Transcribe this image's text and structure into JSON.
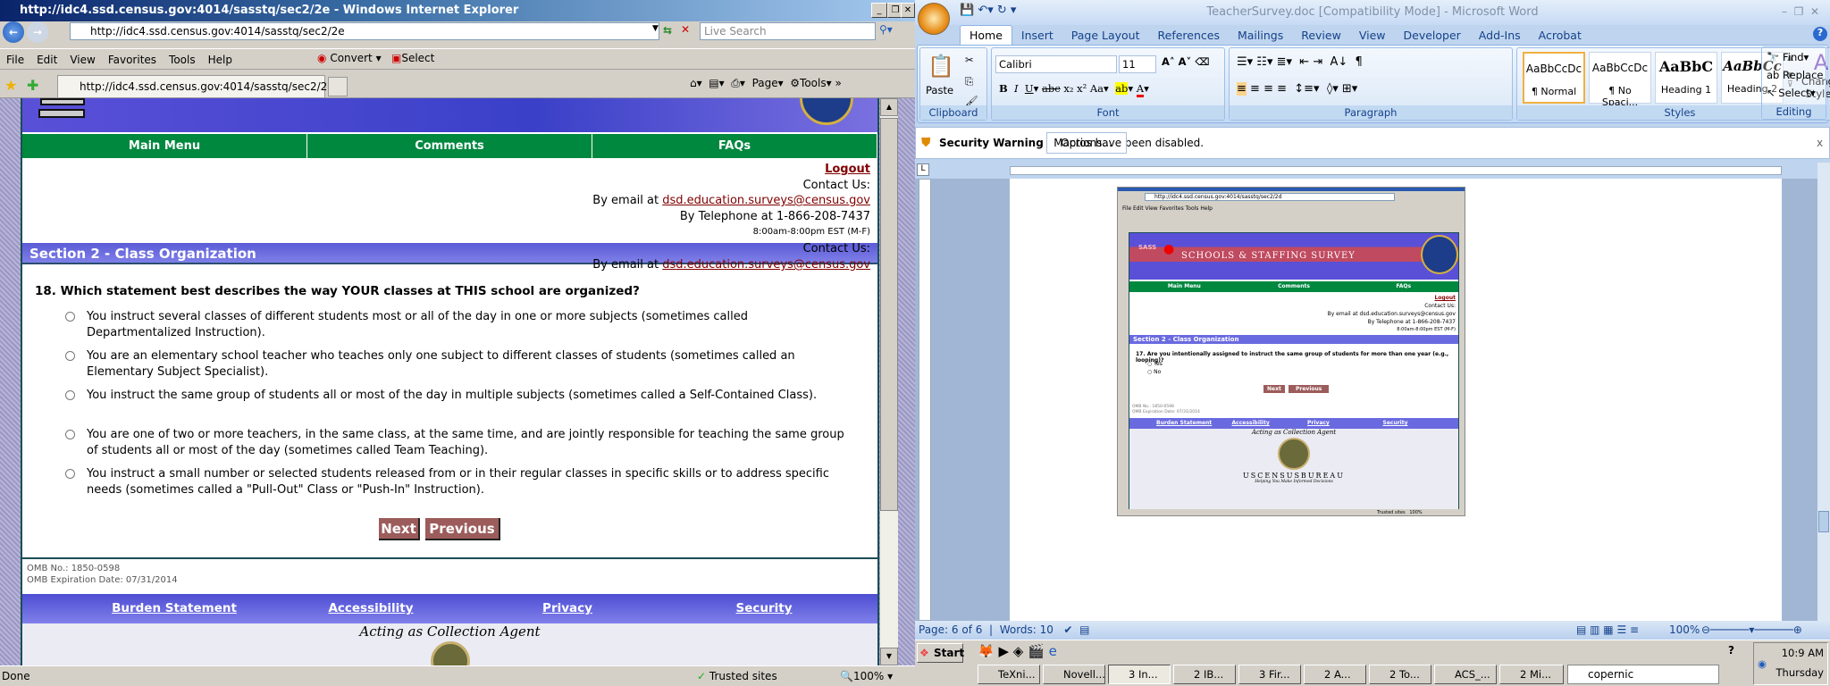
{
  "ie": {
    "title": "http://idc4.ssd.census.gov:4014/sasstq/sec2/2e - Windows Internet Explorer",
    "address": "http://idc4.ssd.census.gov:4014/sasstq/sec2/2e",
    "search_placeholder": "Live Search",
    "menu": [
      "File",
      "Edit",
      "View",
      "Favorites",
      "Tools",
      "Help"
    ],
    "convert": "Convert",
    "select": "Select",
    "tab_label": "http://idc4.ssd.census.gov:4014/sasstq/sec2/2e",
    "cmd": {
      "page": "Page",
      "tools": "Tools"
    },
    "status": {
      "text": "Done",
      "zone": "Trusted sites",
      "zoom": "100%"
    }
  },
  "survey": {
    "nav": [
      "Main Menu",
      "Comments",
      "FAQs"
    ],
    "logout": "Logout",
    "contact_label": "Contact Us:",
    "email_prefix": "By email at ",
    "email": "dsd.education.surveys@census.gov",
    "phone": "By Telephone at 1-866-208-7437",
    "hours": "8:00am-8:00pm EST (M-F)",
    "section": "Section 2 - Class Organization",
    "question": "18. Which statement best describes the way YOUR classes at THIS school are organized?",
    "options": [
      "You instruct several classes of different students most or all of the day in one or more subjects (sometimes called Departmentalized Instruction).",
      "You are an elementary school teacher who teaches only one subject to different classes of students (sometimes called an Elementary Subject Specialist).",
      "You instruct the same group of students all or most of the day in multiple subjects (sometimes called a Self-Contained Class).",
      "You are one of two or more teachers, in the same class, at the same time, and are jointly responsible for teaching the same group of students all or most of the day (sometimes called Team Teaching).",
      "You instruct a small number or selected students released from or in their regular classes in specific skills or to address specific needs (sometimes called a \"Pull-Out\" Class or \"Push-In\" Instruction)."
    ],
    "next": "Next",
    "previous": "Previous",
    "omb_no": "OMB No.: 1850-0598",
    "omb_exp": "OMB Expiration Date: 07/31/2014",
    "footer_links": [
      "Burden Statement",
      "Accessibility",
      "Privacy",
      "Security"
    ],
    "agent": "Acting as Collection Agent"
  },
  "word": {
    "title": "TeacherSurvey.doc [Compatibility Mode] - Microsoft Word",
    "tabs": [
      "Home",
      "Insert",
      "Page Layout",
      "References",
      "Mailings",
      "Review",
      "View",
      "Developer",
      "Add-Ins",
      "Acrobat"
    ],
    "clipboard": {
      "label": "Clipboard",
      "paste": "Paste"
    },
    "font": {
      "label": "Font",
      "name": "Calibri",
      "size": "11"
    },
    "paragraph": {
      "label": "Paragraph"
    },
    "styles": {
      "label": "Styles",
      "items": [
        {
          "sample": "AaBbCcDc",
          "name": "¶ Normal"
        },
        {
          "sample": "AaBbCcDc",
          "name": "¶ No Spaci..."
        },
        {
          "sample": "AaBbC",
          "name": "Heading 1"
        },
        {
          "sample": "AaBbCc",
          "name": "Heading 2"
        }
      ],
      "change": "Change Styles"
    },
    "editing": {
      "label": "Editing",
      "find": "Find",
      "replace": "Replace",
      "select": "Select"
    },
    "security": {
      "title": "Security Warning",
      "message": "Macros have been disabled.",
      "options": "Options..."
    },
    "status": {
      "page": "Page: 6 of 6",
      "words": "Words: 10",
      "zoom": "100%"
    }
  },
  "embedded": {
    "address": "http://idc4.ssd.census.gov:4014/sasstq/sec2/2d",
    "menu": "File  Edit  View  Favorites  Tools  Help",
    "sass": "SASS",
    "banner": "SCHOOLS & STAFFING SURVEY",
    "nav": [
      "Main Menu",
      "Comments",
      "FAQs"
    ],
    "logout": "Logout",
    "contact": "Contact Us:",
    "email": "By email at dsd.education.surveys@census.gov",
    "phone": "By Telephone at 1-866-208-7437",
    "hours": "8:00am-8:00pm EST (M-F)",
    "section": "Section 2 - Class Organization",
    "question": "17. Are you intentionally assigned to instruct the same group of students for more than one year (e.g., looping)?",
    "options": [
      "Yes",
      "No"
    ],
    "next": "Next",
    "previous": "Previous",
    "omb_no": "OMB No.: 1850-0598",
    "omb_exp": "OMB Expiration Date: 07/31/2014",
    "footer_links": [
      "Burden Statement",
      "Accessibility",
      "Privacy",
      "Security"
    ],
    "agent": "Acting as Collection Agent",
    "bureau": "USCENSUSBUREAU",
    "tagline": "Helping You Make Informed Decisions",
    "zone": "Trusted sites",
    "zoom": "100%"
  },
  "taskbar": {
    "start": "Start",
    "items": [
      "TeXni...",
      "Novell...",
      "3 In...",
      "2 IB...",
      "3 Fir...",
      "2 A...",
      "2 To...",
      "ACS_...",
      "2 Mi..."
    ],
    "search": "copernic",
    "time": "10:9 AM",
    "day": "Thursday"
  }
}
